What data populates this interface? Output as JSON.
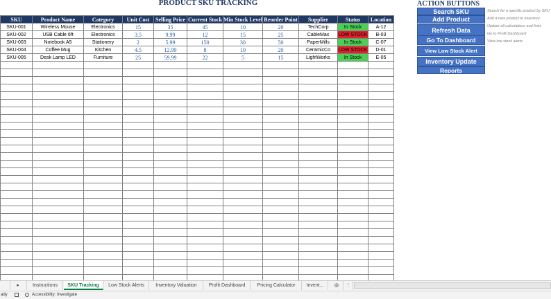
{
  "sheet": {
    "title": "PRODUCT SKU TRACKING",
    "headers": [
      "SKU",
      "Product Name",
      "Category",
      "Unit Cost",
      "Selling Price",
      "Current Stock",
      "Min Stock Level",
      "Reorder Point",
      "Supplier",
      "Status",
      "Location"
    ],
    "rows": [
      [
        "SKU-001",
        "Wireless Mouse",
        "Electronics",
        "15",
        "35",
        "45",
        "10",
        "20",
        "TechCorp",
        "In Stock",
        "A-12"
      ],
      [
        "SKU-002",
        "USB Cable 6ft",
        "Electronics",
        "3.5",
        "9.99",
        "12",
        "15",
        "25",
        "CableMax",
        "LOW STOCK",
        "B-03"
      ],
      [
        "SKU-003",
        "Notebook A5",
        "Stationery",
        "2",
        "5.99",
        "150",
        "30",
        "50",
        "PaperMills",
        "In Stock",
        "C-07"
      ],
      [
        "SKU-004",
        "Coffee Mug",
        "Kitchen",
        "4.5",
        "12.99",
        "8",
        "10",
        "20",
        "CeramicCo",
        "LOW STOCK",
        "D-01"
      ],
      [
        "SKU-005",
        "Desk Lamp LED",
        "Furniture",
        "25",
        "59.99",
        "22",
        "5",
        "15",
        "LightWorks",
        "In Stock",
        "E-05"
      ]
    ]
  },
  "actions": {
    "title": "ACTION BUTTONS",
    "buttons": [
      {
        "label": "Search SKU",
        "desc": "Search for a specific product by SKU"
      },
      {
        "label": "Add Product",
        "desc": "Add a new product to inventory"
      },
      {
        "label": "Refresh Data",
        "desc": "Update all calculations and links"
      },
      {
        "label": "Go To Dashboard",
        "desc": "Go to Profit Dashboard"
      },
      {
        "label": "View Low Stock Alert",
        "desc": "View low stock alerts"
      },
      {
        "label": "Inventory Update",
        "desc": ""
      },
      {
        "label": "Reports",
        "desc": ""
      }
    ]
  },
  "tabs": [
    {
      "label": "Instructions"
    },
    {
      "label": "SKU Tracking"
    },
    {
      "label": "Low Stock Alerts"
    },
    {
      "label": "Inventory Valuation"
    },
    {
      "label": "Profit Dashboard"
    },
    {
      "label": "Pricing Calculator"
    },
    {
      "label": "Invent..."
    }
  ],
  "nav": {
    "next_sheet_icon": "▸",
    "add_sheet_icon": "⊕",
    "more_icon": "⋮"
  },
  "status": {
    "mode": "ady",
    "accessibility": "Accessibility: Investigate"
  },
  "colors": {
    "header_bg": "#1f3864",
    "button_bg": "#4472c4",
    "in_stock": "#4ccf55",
    "low_stock": "#e0202b",
    "active_tab": "#107c41"
  }
}
